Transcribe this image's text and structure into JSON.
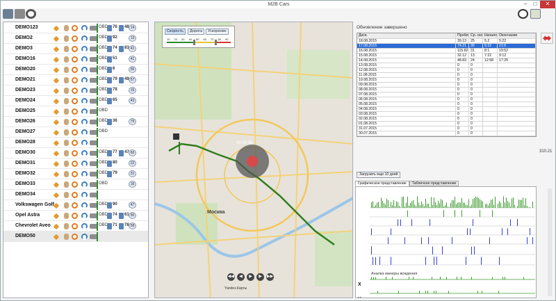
{
  "app": {
    "title": "M2B Cars"
  },
  "window_controls": [
    "–",
    "□",
    "✕"
  ],
  "toolbar": {
    "left_icons": [
      "export-icon",
      "printer-icon",
      "gear-icon"
    ],
    "right_icons": [
      "history-clock-icon",
      "checklist-icon"
    ]
  },
  "vehicles": [
    {
      "name": "DEMO123",
      "obd": "OBD",
      "n1": "76",
      "n2": "48",
      "badge": "14"
    },
    {
      "name": "DEMO2",
      "obd": "OBD",
      "n1": "92",
      "n2": "",
      "badge": "13"
    },
    {
      "name": "DEMO3",
      "obd": "OBD",
      "n1": "74",
      "n2": "83",
      "badge": "41"
    },
    {
      "name": "DEMO16",
      "obd": "OBD",
      "n1": "51",
      "n2": "",
      "badge": "41"
    },
    {
      "name": "DEMO20",
      "obd": "OBD",
      "n1": "6",
      "n2": "",
      "badge": "55"
    },
    {
      "name": "DEMO21",
      "obd": "OBD",
      "n1": "79",
      "n2": "49",
      "badge": "57"
    },
    {
      "name": "DEMO23",
      "obd": "OBD",
      "n1": "78",
      "n2": "",
      "badge": "15"
    },
    {
      "name": "DEMO24",
      "obd": "OBD",
      "n1": "65",
      "n2": "",
      "badge": "43"
    },
    {
      "name": "DEMO25",
      "obd": "OBD",
      "n1": "",
      "n2": "",
      "badge": ""
    },
    {
      "name": "DEMO26",
      "obd": "OBD",
      "n1": "36",
      "n2": "",
      "badge": "79"
    },
    {
      "name": "DEMO27",
      "obd": "OBD",
      "n1": "",
      "n2": "",
      "badge": ""
    },
    {
      "name": "DEMO28",
      "obd": "",
      "n1": "",
      "n2": "",
      "badge": ""
    },
    {
      "name": "DEMO30",
      "obd": "OBD",
      "n1": "77",
      "n2": "47",
      "badge": "60"
    },
    {
      "name": "DEMO31",
      "obd": "OBD",
      "n1": "80",
      "n2": "",
      "badge": "22"
    },
    {
      "name": "DEMO32",
      "obd": "OBD",
      "n1": "79",
      "n2": "",
      "badge": "31"
    },
    {
      "name": "DEMO33",
      "obd": "OBD",
      "n1": "",
      "n2": "",
      "badge": "16"
    },
    {
      "name": "DEMO34",
      "obd": "",
      "n1": "",
      "n2": "",
      "badge": ""
    },
    {
      "name": "Volkswagen Golf",
      "obd": "OBD",
      "n1": "90",
      "n2": "",
      "badge": "47"
    },
    {
      "name": "Opel Astra",
      "obd": "OBD",
      "n1": "74",
      "n2": "61",
      "badge": "55"
    },
    {
      "name": "Chevrolet Aveo",
      "obd": "OBD",
      "n1": "71",
      "n2": "78",
      "badge": "58"
    },
    {
      "name": "DEMO50",
      "obd": "",
      "n1": "",
      "n2": "",
      "badge": ""
    }
  ],
  "map": {
    "buttons": [
      "Скорость",
      "Дорога",
      "Ускорение"
    ],
    "slider_ticks": [
      "10",
      "20",
      "30",
      "40",
      "50",
      "60",
      "70",
      "80",
      "90"
    ],
    "time_label": "05:24:58",
    "city_label": "Москва",
    "scale_text": "Yandex.Карты"
  },
  "right_panel": {
    "status": "Обновление завершено",
    "columns": [
      "Дата",
      "Пробег",
      "Ср. скорость",
      "Начало",
      "Окончание"
    ],
    "rows": [
      [
        "18.08.2015",
        "39.13",
        "25",
        "5.2",
        "5:22"
      ],
      [
        "17.08.2015",
        "74.21",
        "30",
        "5:22",
        "21:6"
      ],
      [
        "16.08.2015",
        "115.82",
        "31",
        "8:1",
        "19:52"
      ],
      [
        "15.08.2015",
        "32.12",
        "13",
        "7:22",
        "9:12"
      ],
      [
        "14.08.2015",
        "48.83",
        "24",
        "12:58",
        "17:25"
      ],
      [
        "13.08.2015",
        "0",
        "0",
        "",
        ""
      ],
      [
        "12.08.2015",
        "0",
        "0",
        "",
        ""
      ],
      [
        "11.08.2015",
        "0",
        "0",
        "",
        ""
      ],
      [
        "10.08.2015",
        "0",
        "0",
        "",
        ""
      ],
      [
        "09.08.2015",
        "0",
        "0",
        "",
        ""
      ],
      [
        "08.08.2015",
        "0",
        "0",
        "",
        ""
      ],
      [
        "07.08.2015",
        "0",
        "0",
        "",
        ""
      ],
      [
        "06.08.2015",
        "0",
        "0",
        "",
        ""
      ],
      [
        "05.08.2015",
        "0",
        "0",
        "",
        ""
      ],
      [
        "04.08.2015",
        "0",
        "0",
        "",
        ""
      ],
      [
        "03.08.2015",
        "0",
        "0",
        "",
        ""
      ],
      [
        "02.08.2015",
        "0",
        "0",
        "",
        ""
      ],
      [
        "01.08.2015",
        "0",
        "0",
        "",
        ""
      ],
      [
        "31.07.2015",
        "0",
        "0",
        "",
        ""
      ],
      [
        "30.07.2015",
        "0",
        "0",
        "",
        ""
      ]
    ],
    "selected_row": 1,
    "load_button": "Загрузить еще 10 дней",
    "tabs": [
      "Графическое представление",
      "Табличное представление"
    ],
    "active_tab": 0,
    "driving_label": "Анализ манеры вождения",
    "axes": [
      "X",
      "Y",
      "Z"
    ],
    "side_value": "310.21"
  },
  "colors": {
    "accent": "#2b6bd3",
    "track": "#2e7d1e",
    "close": "#c8363a",
    "bar_green": "#3c9a2e",
    "bar_blue": "#2f3fd6"
  }
}
